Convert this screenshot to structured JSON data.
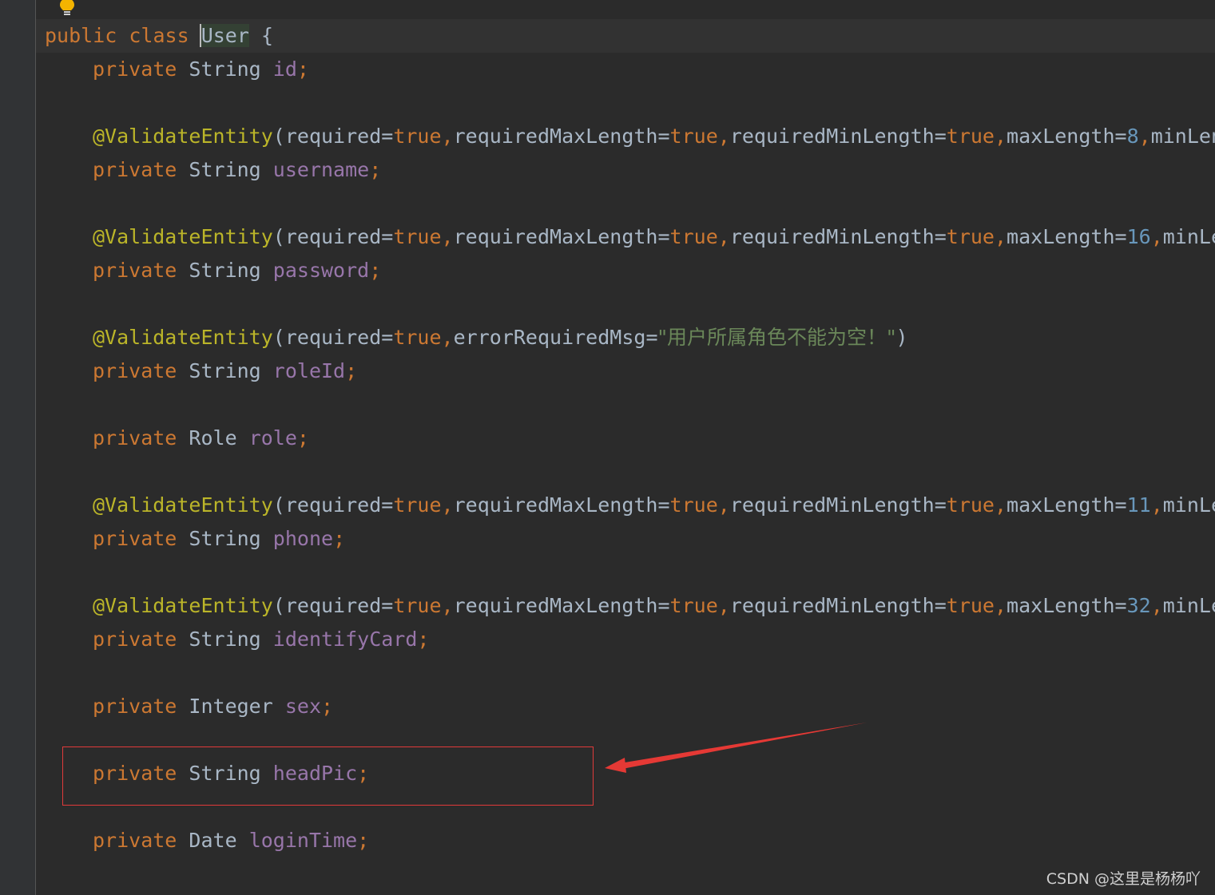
{
  "code": {
    "class_decl": {
      "kw_public": "public",
      "kw_class": "class",
      "name": "User",
      "brace": "{"
    },
    "lines": {
      "id": {
        "kw": "private",
        "type": "String",
        "name": "id",
        "semi": ";"
      },
      "username": {
        "anno": "@ValidateEntity",
        "open": "(",
        "p1": "required",
        "v1": "true",
        "p2": "requiredMaxLength",
        "v2": "true",
        "p3": "requiredMinLength",
        "v3": "true",
        "p4": "maxLength",
        "v4": "8",
        "p5": "minLen",
        "kw": "private",
        "type": "String",
        "name": "username",
        "semi": ";"
      },
      "password": {
        "anno": "@ValidateEntity",
        "open": "(",
        "p1": "required",
        "v1": "true",
        "p2": "requiredMaxLength",
        "v2": "true",
        "p3": "requiredMinLength",
        "v3": "true",
        "p4": "maxLength",
        "v4": "16",
        "p5": "minLe",
        "kw": "private",
        "type": "String",
        "name": "password",
        "semi": ";"
      },
      "roleId": {
        "anno": "@ValidateEntity",
        "open": "(",
        "p1": "required",
        "v1": "true",
        "p2": "errorRequiredMsg",
        "msg": "\"用户所属角色不能为空！\"",
        "close": ")",
        "kw": "private",
        "type": "String",
        "name": "roleId",
        "semi": ";"
      },
      "role": {
        "kw": "private",
        "type": "Role",
        "name": "role",
        "semi": ";"
      },
      "phone": {
        "anno": "@ValidateEntity",
        "open": "(",
        "p1": "required",
        "v1": "true",
        "p2": "requiredMaxLength",
        "v2": "true",
        "p3": "requiredMinLength",
        "v3": "true",
        "p4": "maxLength",
        "v4": "11",
        "p5": "minLe",
        "kw": "private",
        "type": "String",
        "name": "phone",
        "semi": ";"
      },
      "identifyCard": {
        "anno": "@ValidateEntity",
        "open": "(",
        "p1": "required",
        "v1": "true",
        "p2": "requiredMaxLength",
        "v2": "true",
        "p3": "requiredMinLength",
        "v3": "true",
        "p4": "maxLength",
        "v4": "32",
        "p5": "minLe",
        "kw": "private",
        "type": "String",
        "name": "identifyCard",
        "semi": ";"
      },
      "sex": {
        "kw": "private",
        "type": "Integer",
        "name": "sex",
        "semi": ";"
      },
      "headPic": {
        "kw": "private",
        "type": "String",
        "name": "headPic",
        "semi": ";"
      },
      "loginTime": {
        "kw": "private",
        "type": "Date",
        "name": "loginTime",
        "semi": ";"
      }
    },
    "symbols": {
      "eq": "=",
      "comma": ",",
      "space": " "
    }
  },
  "colors": {
    "background": "#2b2b2b",
    "keyword": "#cc7832",
    "field": "#9876aa",
    "annotation": "#bbb529",
    "number": "#6897bb",
    "string": "#6a8759",
    "highlight_box": "#e03a3a",
    "arrow": "#e53935"
  },
  "icons": {
    "bulb": "lightbulb-icon"
  },
  "watermark": "CSDN @这里是杨杨吖"
}
